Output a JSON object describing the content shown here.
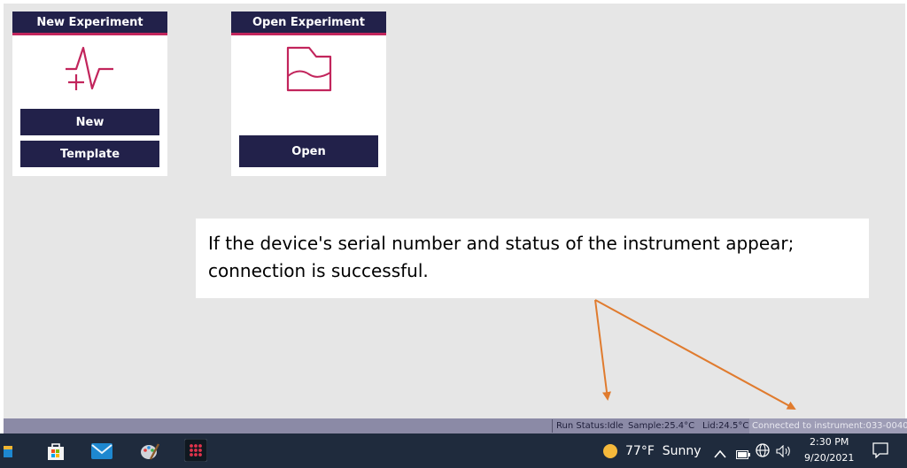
{
  "cards": {
    "new_experiment": {
      "title": "New Experiment",
      "buttons": [
        "New",
        "Template"
      ]
    },
    "open_experiment": {
      "title": "Open Experiment",
      "button": "Open"
    }
  },
  "callout": {
    "line1": "If the device's serial number and status of the instrument appear;",
    "line2": "connection is successful."
  },
  "statusbar": {
    "run_status": "Run Status:Idle",
    "sample": "Sample:25.4°C",
    "lid": "Lid:24.5°C",
    "connection": "Connected to instrument:033-00402"
  },
  "taskbar": {
    "weather": "77°F  Sunny",
    "time": "2:30 PM",
    "date": "9/20/2021",
    "icons": [
      "file-explorer-icon",
      "store-icon",
      "mail-icon",
      "paint-icon",
      "app-grid-icon"
    ]
  },
  "colors": {
    "accent": "#c2255c",
    "button_bg": "#22214a",
    "arrow": "#e07b2e",
    "statusbar": "#8b8aa6",
    "taskbar": "#1f2b3d"
  }
}
